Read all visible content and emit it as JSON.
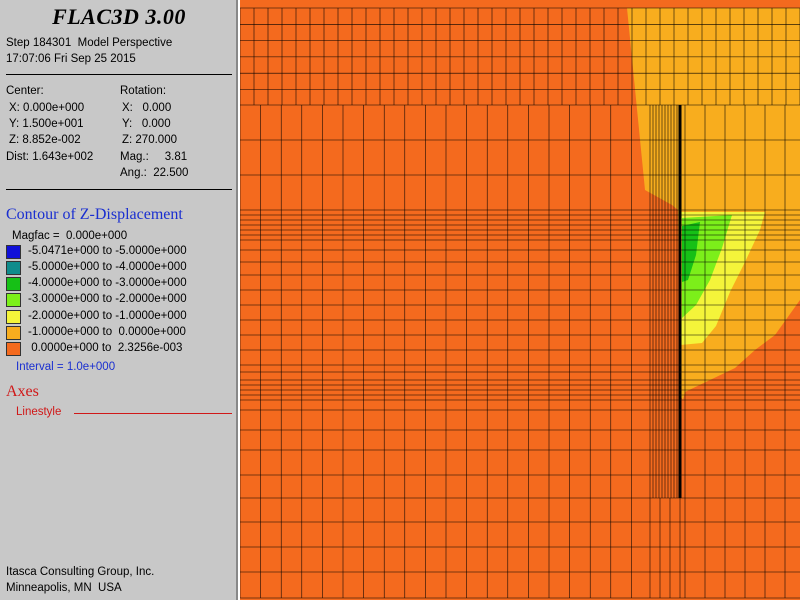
{
  "app_title": "FLAC3D 3.00",
  "header": {
    "step_line": "Step 184301  Model Perspective",
    "date_line": "17:07:06 Fri Sep 25 2015"
  },
  "view": {
    "center_label": "Center:",
    "center_x": "X: 0.000e+000",
    "center_y": "Y: 1.500e+001",
    "center_z": "Z: 8.852e-002",
    "dist": "Dist: 1.643e+002",
    "rotation_label": "Rotation:",
    "rot_x": "X:   0.000",
    "rot_y": "Y:   0.000",
    "rot_z": "Z: 270.000",
    "mag": "Mag.:     3.81",
    "ang": "Ang.:  22.500"
  },
  "contour": {
    "title": "Contour of Z-Displacement",
    "magfac": "Magfac =  0.000e+000",
    "legend": [
      {
        "label": "-5.0471e+000 to -5.0000e+000",
        "color": "#1010d8"
      },
      {
        "label": "-5.0000e+000 to -4.0000e+000",
        "color": "#0f8c8c"
      },
      {
        "label": "-4.0000e+000 to -3.0000e+000",
        "color": "#16c016"
      },
      {
        "label": "-3.0000e+000 to -2.0000e+000",
        "color": "#7cef1a"
      },
      {
        "label": "-2.0000e+000 to -1.0000e+000",
        "color": "#f4f43a"
      },
      {
        "label": "-1.0000e+000 to  0.0000e+000",
        "color": "#f8ad1e"
      },
      {
        "label": " 0.0000e+000 to  2.3256e-003",
        "color": "#f46a1e"
      }
    ],
    "interval": "Interval =  1.0e+000"
  },
  "axes": {
    "title": "Axes",
    "linestyle": "Linestyle"
  },
  "footer": {
    "company": "Itasca Consulting Group, Inc.",
    "location": "Minneapolis, MN  USA"
  }
}
